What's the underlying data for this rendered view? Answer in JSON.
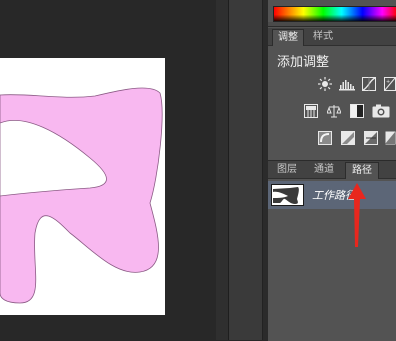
{
  "adjustments_panel": {
    "tabs": [
      "调整",
      "样式"
    ],
    "active_tab": "调整",
    "title": "添加调整",
    "icon_rows": [
      [
        "brightness-contrast-icon",
        "levels-icon",
        "curves-icon",
        "exposure-icon"
      ],
      [
        "vibrance-icon",
        "color-balance-icon",
        "black-white-icon",
        "photo-filter-icon"
      ],
      [
        "invert-icon",
        "posterize-icon",
        "threshold-icon",
        "gradient-map-icon"
      ]
    ]
  },
  "layers_panel": {
    "tabs": [
      "图层",
      "通道",
      "路径"
    ],
    "active_tab": "路径",
    "paths": [
      {
        "name": "工作路径",
        "selected": true
      }
    ]
  },
  "colors": {
    "shape_fill": "#f8b8f0",
    "selected_row": "#5c6677",
    "annotation_arrow": "#e8271e"
  }
}
